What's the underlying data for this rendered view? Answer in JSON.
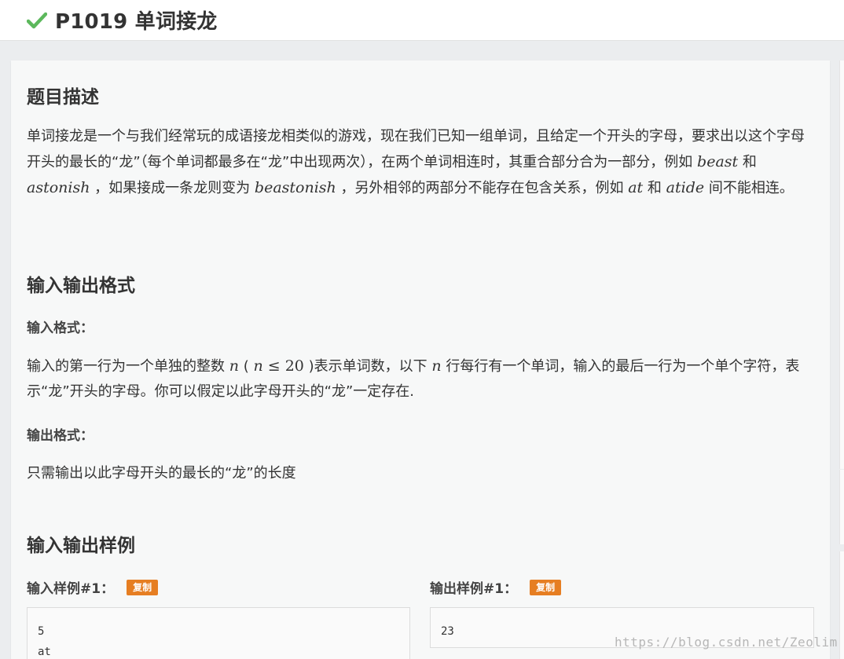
{
  "header": {
    "title": "P1019 单词接龙",
    "status_color": "#5cb85c"
  },
  "description": {
    "heading": "题目描述",
    "p1_a": "单词接龙是一个与我们经常玩的成语接龙相类似的游戏，现在我们已知一组单词，且给定一个开头的字母，要求出以这个字母开头的最长的“龙”（每个单词都最多在“龙”中出现两次），在两个单词相连时，其重合部分合为一部分，例如 ",
    "w1": "beast",
    "p1_b": " 和 ",
    "w2": "astonish",
    "p1_c": " ，如果接成一条龙则变为 ",
    "w3": "beastonish",
    "p1_d": " ，另外相邻的两部分不能存在包含关系，例如 ",
    "w4": "at",
    "p1_e": " 和 ",
    "w5": "atide",
    "p1_f": " 间不能相连。"
  },
  "io_format": {
    "heading": "输入输出格式",
    "input_label": "输入格式：",
    "in_a": "输入的第一行为一个单独的整数 ",
    "var_n": "n",
    "in_b": " ( ",
    "in_le": " ≤ 20",
    "in_c": " )表示单词数，以下 ",
    "in_d": " 行每行有一个单词，输入的最后一行为一个单个字符，表示“龙”开头的字母。你可以假定以此字母开头的“龙”一定存在.",
    "output_label": "输出格式：",
    "output_text": "只需输出以此字母开头的最长的“龙”的长度"
  },
  "samples": {
    "heading": "输入输出样例",
    "input_label": "输入样例#1：",
    "output_label": "输出样例#1：",
    "copy_label": "复制",
    "input_lines": [
      "5",
      "at"
    ],
    "output_lines": [
      "23"
    ]
  },
  "watermark": "https://blog.csdn.net/Zeolim"
}
